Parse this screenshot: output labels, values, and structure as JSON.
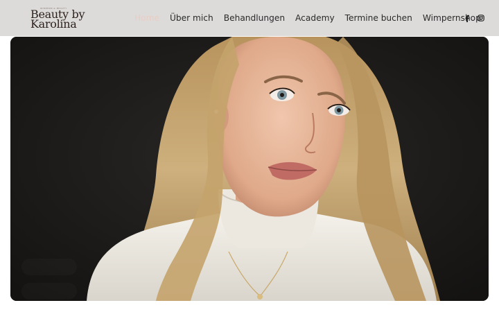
{
  "brand": {
    "line1": "Beauty by",
    "line2": "Karolina",
    "tagline_tiny": "WIMPERN & BEAUTY"
  },
  "nav": {
    "items": [
      {
        "label": "Home",
        "active": true
      },
      {
        "label": "Über mich",
        "active": false
      },
      {
        "label": "Behandlungen",
        "active": false
      },
      {
        "label": "Academy",
        "active": false
      },
      {
        "label": "Termine buchen",
        "active": false
      },
      {
        "label": "Wimpernshop",
        "active": false
      }
    ]
  },
  "social": {
    "facebook_icon": "facebook-icon",
    "instagram_icon": "instagram-icon"
  },
  "hero": {
    "image_subject": "portrait-photo",
    "overlay_title": "",
    "overlay_subtitle": ""
  },
  "colors": {
    "header_bg": "#dcdbda",
    "nav_active": "#e9cdc4",
    "nav_text": "#2a2a2a",
    "logo_text": "#2d211d",
    "hero_bg": "#1b1a19"
  }
}
